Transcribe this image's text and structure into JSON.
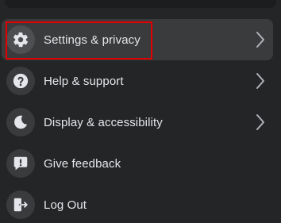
{
  "menu": {
    "items": [
      {
        "label": "Settings & privacy",
        "icon": "gear-icon",
        "has_chevron": true
      },
      {
        "label": "Help & support",
        "icon": "question-icon",
        "has_chevron": true
      },
      {
        "label": "Display & accessibility",
        "icon": "moon-icon",
        "has_chevron": true
      },
      {
        "label": "Give feedback",
        "icon": "feedback-icon",
        "has_chevron": false
      },
      {
        "label": "Log Out",
        "icon": "logout-icon",
        "has_chevron": false
      }
    ]
  },
  "colors": {
    "background": "#242526",
    "active_row": "#3a3b3c",
    "icon_circle": "#3a3b3c",
    "text": "#e4e6eb",
    "highlight": "#e00000"
  }
}
